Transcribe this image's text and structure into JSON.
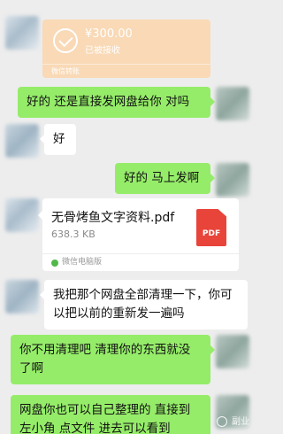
{
  "transfer": {
    "amount": "¥300.00",
    "status": "已被接收",
    "footer": "微信转账"
  },
  "messages": {
    "m1": "好的 还是直接发网盘给你 对吗",
    "m2": "好",
    "m3": "好的 马上发啊",
    "m4": "我把那个网盘全部清理一下，你可以把以前的重新发一遍吗",
    "m5": "你不用清理吧 清理你的东西就没了啊",
    "m6": "网盘你也可以自己整理的 直接到左小角 点文件 进去可以看到"
  },
  "file": {
    "name": "无骨烤鱼文字资料.pdf",
    "size": "638.3 KB",
    "badge": "PDF",
    "source": "微信电脑版"
  },
  "watermark": {
    "text": "副业"
  }
}
